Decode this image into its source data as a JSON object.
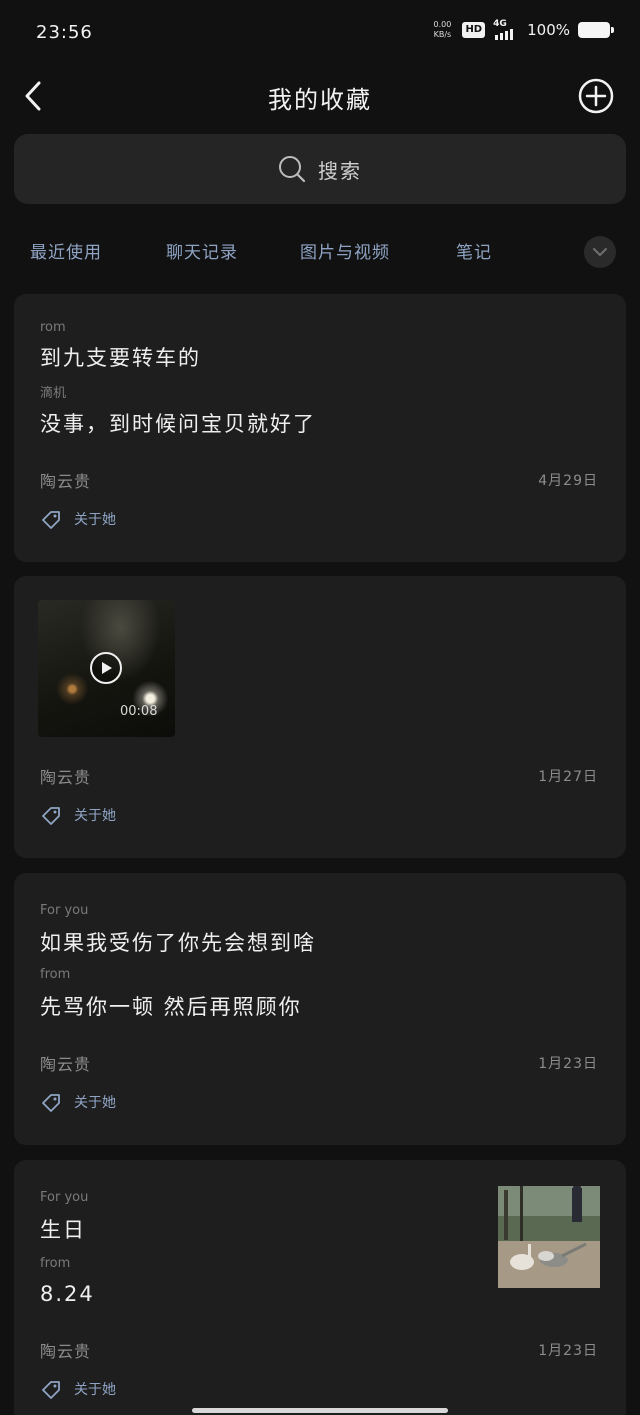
{
  "status_bar": {
    "time": "23:56",
    "net_speed_value": "0.00",
    "net_speed_unit": "KB/s",
    "hd_label": "HD",
    "signal_label": "4G",
    "battery_percent": "100%"
  },
  "nav": {
    "title": "我的收藏",
    "back_icon": "chevron-left-icon",
    "add_icon": "plus-circle-icon"
  },
  "search": {
    "placeholder": "搜索",
    "icon": "search-icon"
  },
  "filter_tabs": [
    {
      "label": "最近使用"
    },
    {
      "label": "聊天记录"
    },
    {
      "label": "图片与视频"
    },
    {
      "label": "笔记"
    }
  ],
  "items": [
    {
      "type": "chat",
      "lines": [
        {
          "sender": "rom",
          "text": "到九支要转车的"
        },
        {
          "sender": "滴机",
          "text": "没事，到时候问宝贝就好了"
        }
      ],
      "source": "陶云贵",
      "date": "4月29日",
      "tag": "关于她"
    },
    {
      "type": "video",
      "duration": "00:08",
      "source": "陶云贵",
      "date": "1月27日",
      "tag": "关于她"
    },
    {
      "type": "chat",
      "lines": [
        {
          "sender": "For you",
          "text": "如果我受伤了你先会想到啥"
        },
        {
          "sender": "from",
          "text": "先骂你一顿 然后再照顾你"
        }
      ],
      "source": "陶云贵",
      "date": "1月23日",
      "tag": "关于她"
    },
    {
      "type": "chat_with_image",
      "lines": [
        {
          "sender": "For you",
          "text": "生日"
        },
        {
          "sender": "from",
          "text": "8.24"
        }
      ],
      "source": "陶云贵",
      "date": "1月23日",
      "tag": "关于她"
    }
  ],
  "colors": {
    "background": "#111111",
    "card": "#1e1e1e",
    "accent_text": "#8fa4c4",
    "primary_text": "#efefef",
    "secondary_text": "#8c8c8c"
  }
}
